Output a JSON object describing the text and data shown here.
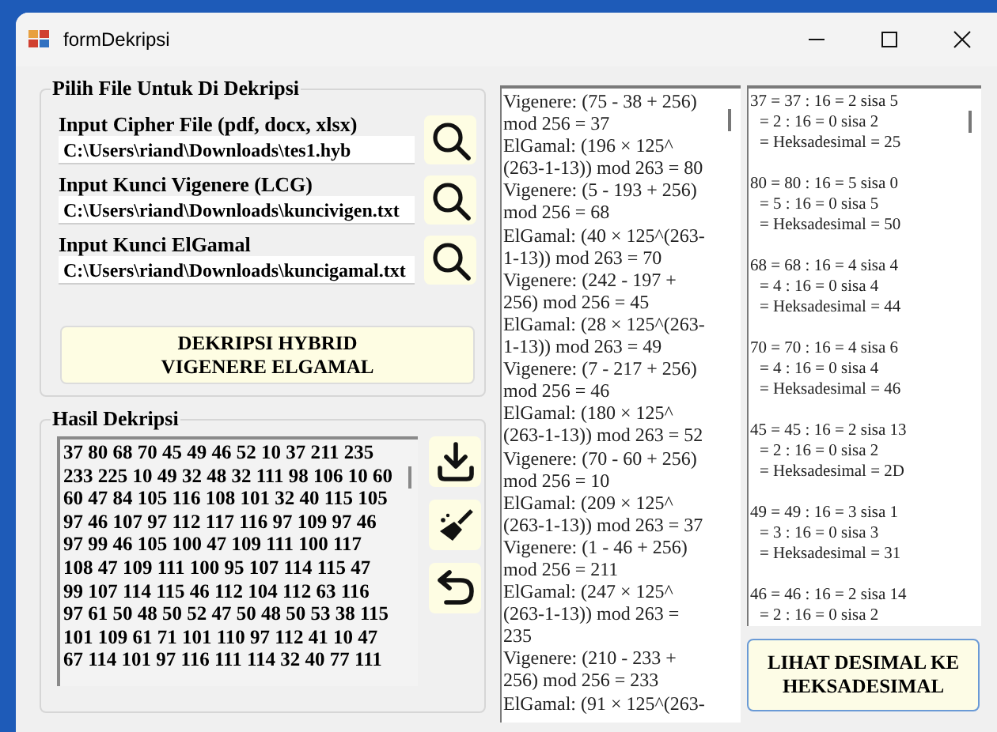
{
  "window": {
    "title": "formDekripsi"
  },
  "file_group": {
    "title": "Pilih File Untuk Di Dekripsi",
    "inputs": [
      {
        "label": "Input Cipher File (pdf, docx, xlsx)",
        "value": "C:\\Users\\riand\\Downloads\\tes1.hyb"
      },
      {
        "label": "Input Kunci Vigenere (LCG)",
        "value": "C:\\Users\\riand\\Downloads\\kuncivigen.txt"
      },
      {
        "label": "Input Kunci ElGamal",
        "value": "C:\\Users\\riand\\Downloads\\kuncigamal.txt"
      }
    ],
    "decrypt_button": "DEKRIPSI HYBRID VIGENERE ELGAMAL"
  },
  "result_group": {
    "title": "Hasil Dekripsi",
    "lines": [
      "37 80 68 70 45 49 46 52 10 37 211 235",
      "233 225 10 49 32 48 32 111 98 106 10 60",
      "60 47 84 105 116 108 101 32 40 115 105",
      "97 46 107 97 112 117 116 97 109 97 46",
      "97 99 46 105 100 47 109 111 100 117",
      "108 47 109 111 100 95 107 114 115 47",
      "99 107 114 115 46 112 104 112 63 116",
      "97 61 50 48 50 52 47 50 48 50 53 38 115",
      "101 109 61 71 101 110 97 112 41 10 47",
      "67 114 101 97 116 111 114 32 40 77 111"
    ],
    "actions": [
      {
        "kind": "save"
      },
      {
        "kind": "clear"
      },
      {
        "kind": "back"
      }
    ]
  },
  "steps": {
    "lines": [
      "Vigenere: (75 - 38 + 256)",
      "mod 256 = 37",
      "ElGamal: (196 × 125^",
      "(263-1-13)) mod 263 = 80",
      "Vigenere: (5 - 193 + 256)",
      "mod 256 = 68",
      "ElGamal: (40 × 125^(263-",
      "1-13)) mod 263 = 70",
      "Vigenere: (242 - 197 +",
      "256) mod 256 = 45",
      "ElGamal: (28 × 125^(263-",
      "1-13)) mod 263 = 49",
      "Vigenere: (7 - 217 + 256)",
      "mod 256 = 46",
      "ElGamal: (180 × 125^",
      "(263-1-13)) mod 263 = 52",
      "Vigenere: (70 - 60 + 256)",
      "mod 256 = 10",
      "ElGamal: (209 × 125^",
      "(263-1-13)) mod 263 = 37",
      "Vigenere: (1 - 46 + 256)",
      "mod 256 = 211",
      "ElGamal: (247 × 125^",
      "(263-1-13)) mod 263 =",
      "235",
      "Vigenere: (210 - 233 +",
      "256) mod 256 = 233",
      "ElGamal: (91 × 125^(263-"
    ]
  },
  "hex": {
    "entries": [
      [
        "37 = 37 : 16 = 2 sisa 5",
        "= 2 : 16 = 0 sisa 2",
        "= Heksadesimal = 25"
      ],
      [
        "80 = 80 : 16 = 5 sisa 0",
        "= 5 : 16 = 0 sisa 5",
        "= Heksadesimal = 50"
      ],
      [
        "68 = 68 : 16 = 4 sisa 4",
        "= 4 : 16 = 0 sisa 4",
        "= Heksadesimal = 44"
      ],
      [
        "70 = 70 : 16 = 4 sisa 6",
        "= 4 : 16 = 0 sisa 4",
        "= Heksadesimal = 46"
      ],
      [
        "45 = 45 : 16 = 2 sisa 13",
        "= 2 : 16 = 0 sisa 2",
        "= Heksadesimal = 2D"
      ],
      [
        "49 = 49 : 16 = 3 sisa 1",
        "= 3 : 16 = 0 sisa 3",
        "= Heksadesimal = 31"
      ],
      [
        "46 = 46 : 16 = 2 sisa 14",
        "= 2 : 16 = 0 sisa 2"
      ]
    ],
    "button": "LIHAT DESIMAL KE HEKSADESIMAL"
  }
}
